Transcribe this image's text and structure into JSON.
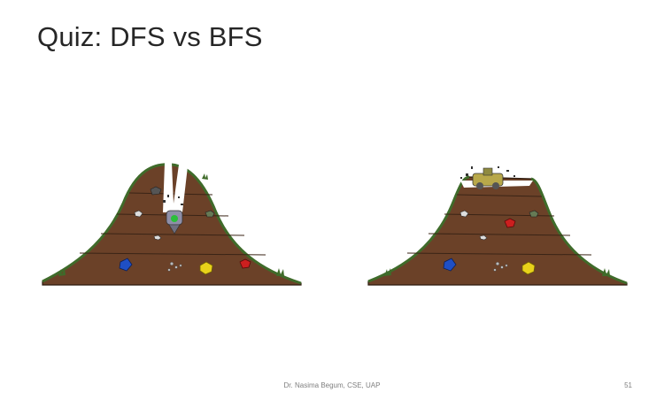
{
  "slide": {
    "title": "Quiz: DFS vs BFS",
    "footer": "Dr. Nasima Begum, CSE, UAP",
    "page_number": "51"
  },
  "colors": {
    "dirt": "#6b4128",
    "dirt_line": "#3a2416",
    "grass": "#3f6b2a",
    "blue_gem": "#1f4fc4",
    "yellow_gem": "#e8d21a",
    "red_gem": "#cc1f1f"
  },
  "scenes": [
    {
      "name": "dfs-scene",
      "agent": "drill-robot-icon",
      "digging": "deep-vertical-shaft"
    },
    {
      "name": "bfs-scene",
      "agent": "bulldozer-icon",
      "digging": "shallow-top-layer"
    }
  ]
}
